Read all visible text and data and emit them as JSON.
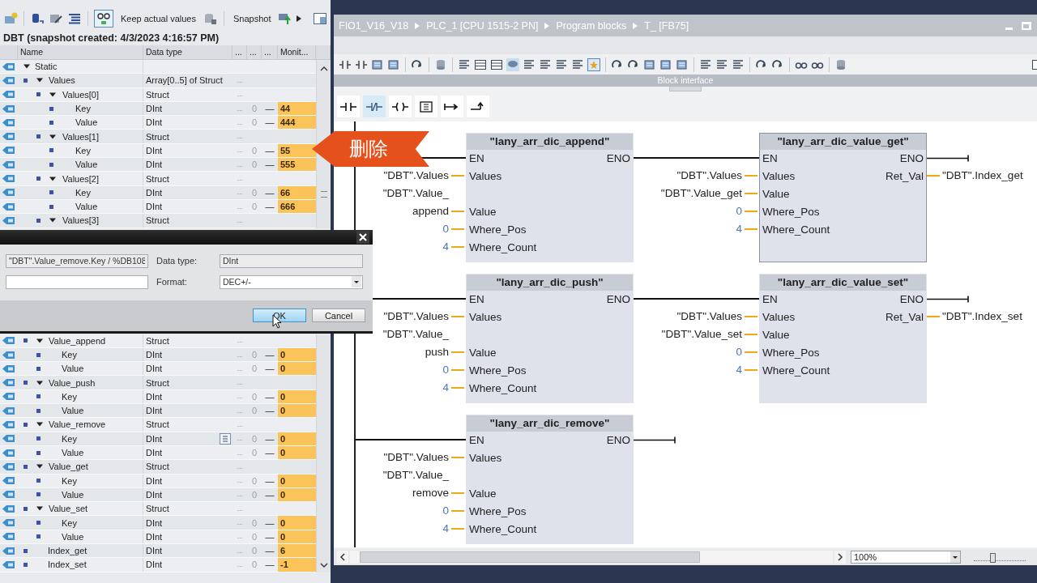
{
  "variables": {
    "toolbar": {
      "keep_button": "Keep actual values",
      "snapshot_button": "Snapshot"
    },
    "title": "DBT (snapshot created: 4/3/2023 4:16:57 PM)",
    "columns": [
      "Name",
      "Data type",
      "...",
      "...",
      "...",
      "Monit..."
    ],
    "rows_above_dialog": [
      {
        "name": "Static",
        "kind": "struct",
        "expanded": true,
        "selected": false,
        "children": [
          {
            "name": "Values",
            "type": "Array[0..5] of Struct",
            "kind": "struct",
            "expanded": true,
            "selected": false,
            "col_3": "...",
            "children": [
              {
                "name": "Values[0]",
                "type": "Struct",
                "kind": "struct",
                "expanded": true,
                "selected": false,
                "col_3": "...",
                "children": [
                  {
                    "name": "Key",
                    "type": "DInt",
                    "kind": "leaf",
                    "selected": false,
                    "col_3": "...",
                    "col_4": "0",
                    "col_5": "—",
                    "monitor": "44"
                  },
                  {
                    "name": "Value",
                    "type": "DInt",
                    "kind": "leaf",
                    "selected": false,
                    "col_3": "...",
                    "col_4": "0",
                    "col_5": "—",
                    "monitor": "444"
                  }
                ]
              },
              {
                "name": "Values[1]",
                "type": "Struct",
                "kind": "struct",
                "expanded": true,
                "selected": false,
                "col_3": "...",
                "children": [
                  {
                    "name": "Key",
                    "type": "DInt",
                    "kind": "leaf",
                    "selected": false,
                    "col_3": "...",
                    "col_4": "0",
                    "col_5": "—",
                    "monitor": "55"
                  },
                  {
                    "name": "Value",
                    "type": "DInt",
                    "kind": "leaf",
                    "selected": false,
                    "col_3": "...",
                    "col_4": "0",
                    "col_5": "—",
                    "monitor": "555"
                  }
                ]
              },
              {
                "name": "Values[2]",
                "type": "Struct",
                "kind": "struct",
                "expanded": true,
                "selected": false,
                "col_3": "...",
                "children": [
                  {
                    "name": "Key",
                    "type": "DInt",
                    "kind": "leaf",
                    "selected": false,
                    "col_3": "...",
                    "col_4": "0",
                    "col_5": "—",
                    "monitor": "66"
                  },
                  {
                    "name": "Value",
                    "type": "DInt",
                    "kind": "leaf",
                    "selected": false,
                    "col_3": "...",
                    "col_4": "0",
                    "col_5": "—",
                    "monitor": "666"
                  }
                ]
              },
              {
                "name": "Values[3]",
                "type": "Struct",
                "kind": "struct",
                "expanded": true,
                "selected": false,
                "col_3": "..."
              }
            ]
          }
        ]
      }
    ],
    "rows_below_dialog": [
      {
        "name": "Value_append",
        "type": "Struct",
        "kind": "struct",
        "expanded": true,
        "selected": false,
        "col_3": "...",
        "children": [
          {
            "name": "Key",
            "type": "DInt",
            "kind": "leaf",
            "selected": false,
            "col_3": "...",
            "col_4": "0",
            "col_5": "—",
            "monitor": "0"
          },
          {
            "name": "Value",
            "type": "DInt",
            "kind": "leaf",
            "selected": false,
            "col_3": "...",
            "col_4": "0",
            "col_5": "—",
            "monitor": "0"
          }
        ]
      },
      {
        "name": "Value_push",
        "type": "Struct",
        "kind": "struct",
        "expanded": true,
        "selected": false,
        "col_3": "...",
        "children": [
          {
            "name": "Key",
            "type": "DInt",
            "kind": "leaf",
            "selected": false,
            "col_3": "...",
            "col_4": "0",
            "col_5": "—",
            "monitor": "0"
          },
          {
            "name": "Value",
            "type": "DInt",
            "kind": "leaf",
            "selected": false,
            "col_3": "...",
            "col_4": "0",
            "col_5": "—",
            "monitor": "0"
          }
        ]
      },
      {
        "name": "Value_remove",
        "type": "Struct",
        "kind": "struct",
        "expanded": true,
        "selected": false,
        "col_3": "...",
        "children": [
          {
            "name": "Key",
            "type": "DInt",
            "kind": "leaf",
            "selected": true,
            "col_3": "...",
            "col_4": "0",
            "col_5": "—",
            "monitor": "0"
          },
          {
            "name": "Value",
            "type": "DInt",
            "kind": "leaf",
            "selected": false,
            "col_3": "...",
            "col_4": "0",
            "col_5": "—",
            "monitor": "0"
          }
        ]
      },
      {
        "name": "Value_get",
        "type": "Struct",
        "kind": "struct",
        "expanded": true,
        "selected": false,
        "col_3": "...",
        "children": [
          {
            "name": "Key",
            "type": "DInt",
            "kind": "leaf",
            "selected": false,
            "col_3": "...",
            "col_4": "0",
            "col_5": "—",
            "monitor": "0"
          },
          {
            "name": "Value",
            "type": "DInt",
            "kind": "leaf",
            "selected": false,
            "col_3": "...",
            "col_4": "0",
            "col_5": "—",
            "monitor": "0"
          }
        ]
      },
      {
        "name": "Value_set",
        "type": "Struct",
        "kind": "struct",
        "expanded": true,
        "selected": false,
        "col_3": "...",
        "children": [
          {
            "name": "Key",
            "type": "DInt",
            "kind": "leaf",
            "selected": false,
            "col_3": "...",
            "col_4": "0",
            "col_5": "—",
            "monitor": "0"
          },
          {
            "name": "Value",
            "type": "DInt",
            "kind": "leaf",
            "selected": false,
            "col_3": "...",
            "col_4": "0",
            "col_5": "—",
            "monitor": "0"
          }
        ]
      },
      {
        "name": "Index_get",
        "type": "DInt",
        "kind": "leaf",
        "selected": false,
        "col_3": "...",
        "col_4": "0",
        "col_5": "—",
        "monitor": "6"
      },
      {
        "name": "Index_set",
        "type": "DInt",
        "kind": "leaf",
        "selected": false,
        "col_3": "...",
        "col_4": "0",
        "col_5": "—",
        "monitor": "-1"
      }
    ]
  },
  "dialog": {
    "address": "\"DBT\".Value_remove.Key / %DB108",
    "data_type_label": "Data type:",
    "data_type": "DInt",
    "format_label": "Format:",
    "format": "DEC+/-",
    "buttons": [
      {
        "label": "OK",
        "selected": true
      },
      {
        "label": "Cancel",
        "selected": false
      }
    ]
  },
  "editor": {
    "breadcrumb": [
      "FIO1_V16_V18",
      "PLC_1 [CPU 1515-2 PN]",
      "Program blocks",
      "T_ [FB75]"
    ],
    "block_interface": "Block interface",
    "lad_toolbar": [
      {
        "kind": "contact_no",
        "selected": false
      },
      {
        "kind": "contact_nc",
        "selected": true
      },
      {
        "kind": "coil",
        "selected": false
      },
      {
        "kind": "box",
        "selected": false
      },
      {
        "kind": "open_branch",
        "selected": false
      },
      {
        "kind": "close_branch",
        "selected": false
      }
    ],
    "networks": [
      {
        "blocks": [
          {
            "title": "\"lany_arr_dic_append\"",
            "selected": false,
            "en": "EN",
            "eno": "ENO",
            "inputs": [
              {
                "pin": "Values",
                "operand": "\"DBT\".Values",
                "kind": "tag"
              },
              {
                "pin": "Value",
                "operand": "\"DBT\".Value_\nappend",
                "kind": "tag"
              },
              {
                "pin": "Where_Pos",
                "operand": "0",
                "kind": "constant"
              },
              {
                "pin": "Where_Count",
                "operand": "4",
                "kind": "constant"
              }
            ]
          },
          {
            "title": "\"lany_arr_dic_value_get\"",
            "selected": true,
            "en": "EN",
            "eno": "ENO",
            "inputs": [
              {
                "pin": "Values",
                "operand": "\"DBT\".Values",
                "kind": "tag"
              },
              {
                "pin": "Value",
                "operand": "\"DBT\".Value_get",
                "kind": "tag"
              },
              {
                "pin": "Where_Pos",
                "operand": "0",
                "kind": "constant"
              },
              {
                "pin": "Where_Count",
                "operand": "4",
                "kind": "constant"
              }
            ],
            "outputs": [
              {
                "pin": "Ret_Val",
                "operand": "\"DBT\".Index_get"
              }
            ]
          }
        ]
      },
      {
        "blocks": [
          {
            "title": "\"lany_arr_dic_push\"",
            "selected": false,
            "en": "EN",
            "eno": "ENO",
            "inputs": [
              {
                "pin": "Values",
                "operand": "\"DBT\".Values",
                "kind": "tag"
              },
              {
                "pin": "Value",
                "operand": "\"DBT\".Value_\npush",
                "kind": "tag"
              },
              {
                "pin": "Where_Pos",
                "operand": "0",
                "kind": "constant"
              },
              {
                "pin": "Where_Count",
                "operand": "4",
                "kind": "constant"
              }
            ]
          },
          {
            "title": "\"lany_arr_dic_value_set\"",
            "selected": false,
            "en": "EN",
            "eno": "ENO",
            "inputs": [
              {
                "pin": "Values",
                "operand": "\"DBT\".Values",
                "kind": "tag"
              },
              {
                "pin": "Value",
                "operand": "\"DBT\".Value_set",
                "kind": "tag"
              },
              {
                "pin": "Where_Pos",
                "operand": "0",
                "kind": "constant"
              },
              {
                "pin": "Where_Count",
                "operand": "4",
                "kind": "constant"
              }
            ],
            "outputs": [
              {
                "pin": "Ret_Val",
                "operand": "\"DBT\".Index_set"
              }
            ]
          }
        ]
      },
      {
        "blocks": [
          {
            "title": "\"lany_arr_dic_remove\"",
            "selected": false,
            "en": "EN",
            "eno": "ENO",
            "inputs": [
              {
                "pin": "Values",
                "operand": "\"DBT\".Values",
                "kind": "tag"
              },
              {
                "pin": "Value",
                "operand": "\"DBT\".Value_\nremove",
                "kind": "tag"
              },
              {
                "pin": "Where_Pos",
                "operand": "0",
                "kind": "constant"
              },
              {
                "pin": "Where_Count",
                "operand": "4",
                "kind": "constant"
              }
            ]
          }
        ]
      }
    ],
    "zoom": "100%",
    "zoom_slider": {
      "level": 0.35
    }
  },
  "callout": {
    "text": "删除"
  }
}
